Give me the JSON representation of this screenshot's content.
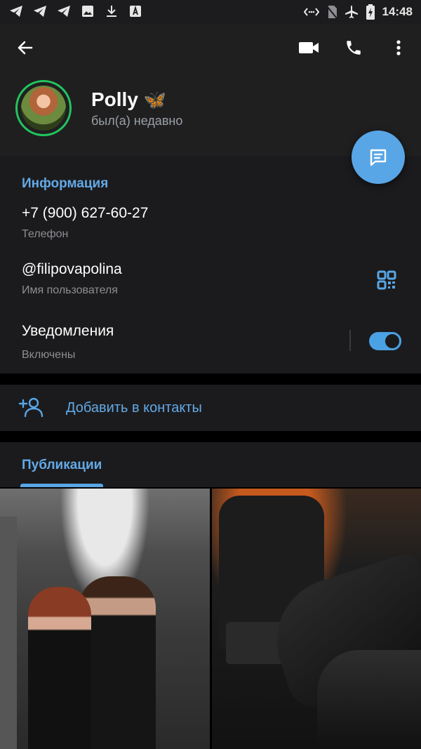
{
  "status_bar": {
    "time": "14:48"
  },
  "header": {
    "name": "Polly",
    "emoji": "🦋",
    "last_seen": "был(а) недавно"
  },
  "info": {
    "section_title": "Информация",
    "phone_value": "+7 (900) 627-60-27",
    "phone_label": "Телефон",
    "username_value": "@filipovapolina",
    "username_label": "Имя пользователя",
    "notifications_title": "Уведомления",
    "notifications_state": "Включены",
    "notifications_on": true
  },
  "add_contact": {
    "label": "Добавить в контакты"
  },
  "publications": {
    "tab_label": "Публикации"
  },
  "colors": {
    "accent": "#58a6e6",
    "online_ring": "#22c55e"
  }
}
